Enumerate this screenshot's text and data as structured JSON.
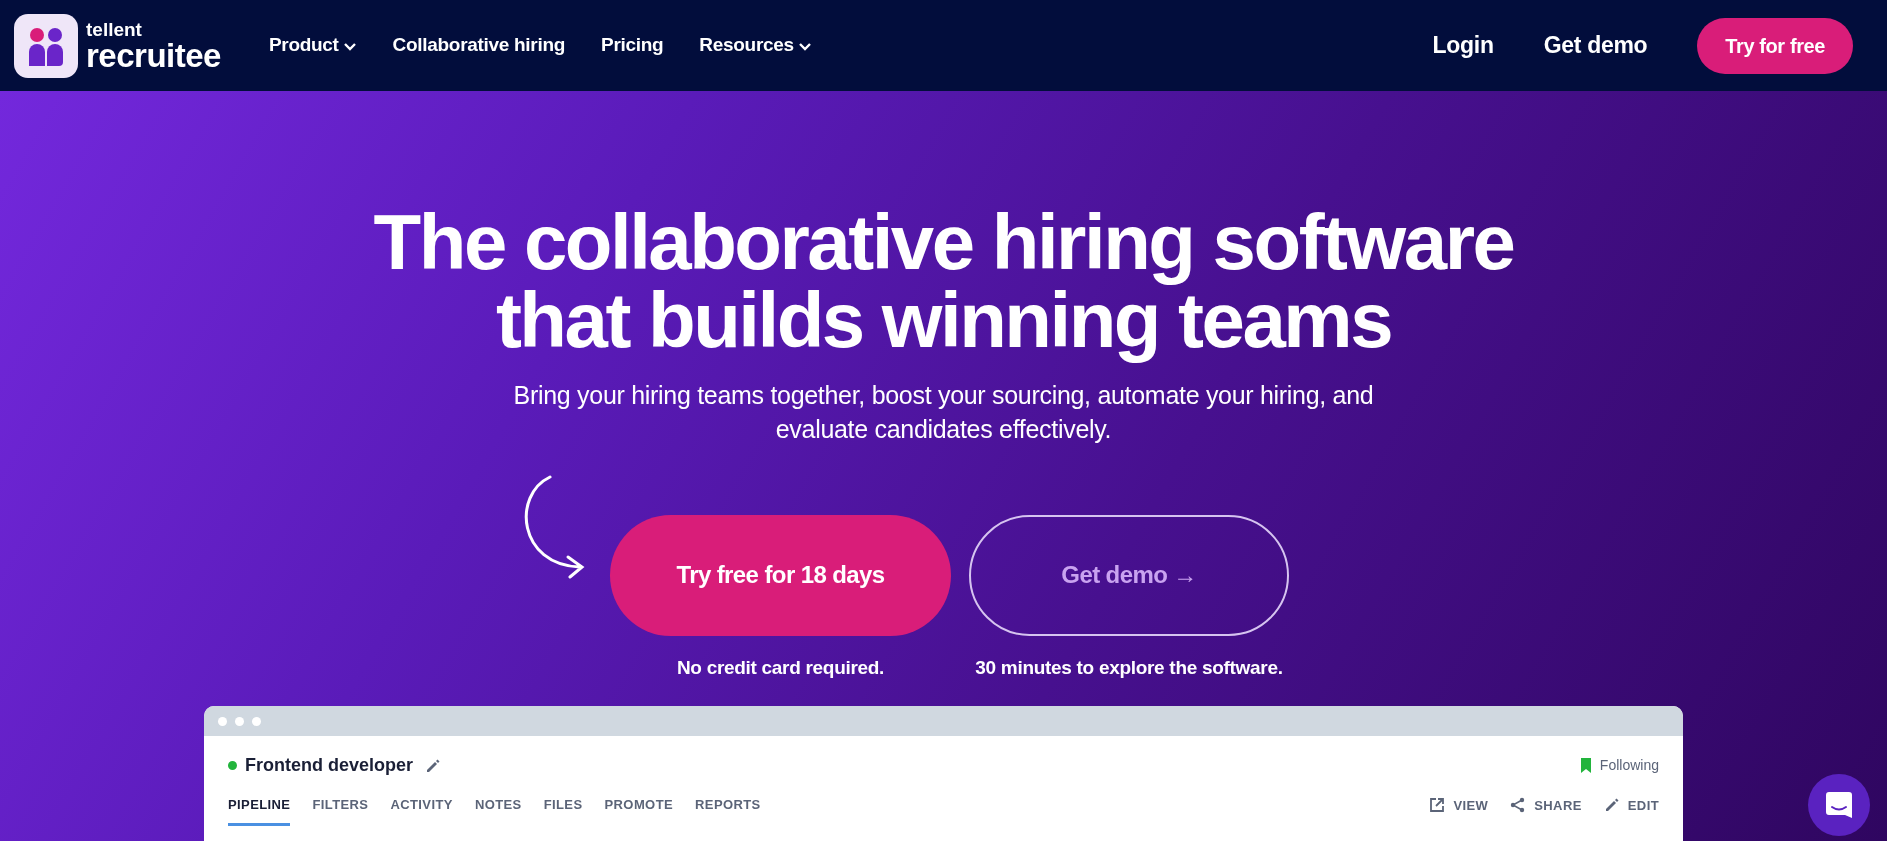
{
  "navbar": {
    "logo": {
      "top": "tellent",
      "bottom": "recruitee"
    },
    "links": [
      {
        "label": "Product",
        "dropdown": true
      },
      {
        "label": "Collaborative hiring",
        "dropdown": false
      },
      {
        "label": "Pricing",
        "dropdown": false
      },
      {
        "label": "Resources",
        "dropdown": true
      }
    ],
    "login": "Login",
    "demo": "Get demo",
    "cta": "Try for free"
  },
  "hero": {
    "title_lines": [
      "The collaborative hiring software",
      "that builds winning teams"
    ],
    "subtitle_lines": [
      "Bring your hiring teams together, boost your sourcing, automate your hiring, and",
      "evaluate candidates effectively."
    ],
    "primary": {
      "label": "Try free for 18 days",
      "caption": "No credit card required."
    },
    "secondary": {
      "label": "Get demo →",
      "caption": "30 minutes to explore the software."
    }
  },
  "app_preview": {
    "job_title": "Frontend developer",
    "active": true,
    "following": "Following",
    "tabs": [
      {
        "label": "PIPELINE",
        "selected": true
      },
      {
        "label": "FILTERS",
        "selected": false
      },
      {
        "label": "ACTIVITY",
        "selected": false
      },
      {
        "label": "NOTES",
        "selected": false
      },
      {
        "label": "FILES",
        "selected": false
      },
      {
        "label": "PROMOTE",
        "selected": false
      },
      {
        "label": "REPORTS",
        "selected": false
      }
    ],
    "actions": [
      {
        "kind": "view",
        "label": "VIEW"
      },
      {
        "kind": "share",
        "label": "SHARE"
      },
      {
        "kind": "edit",
        "label": "EDIT"
      }
    ]
  }
}
